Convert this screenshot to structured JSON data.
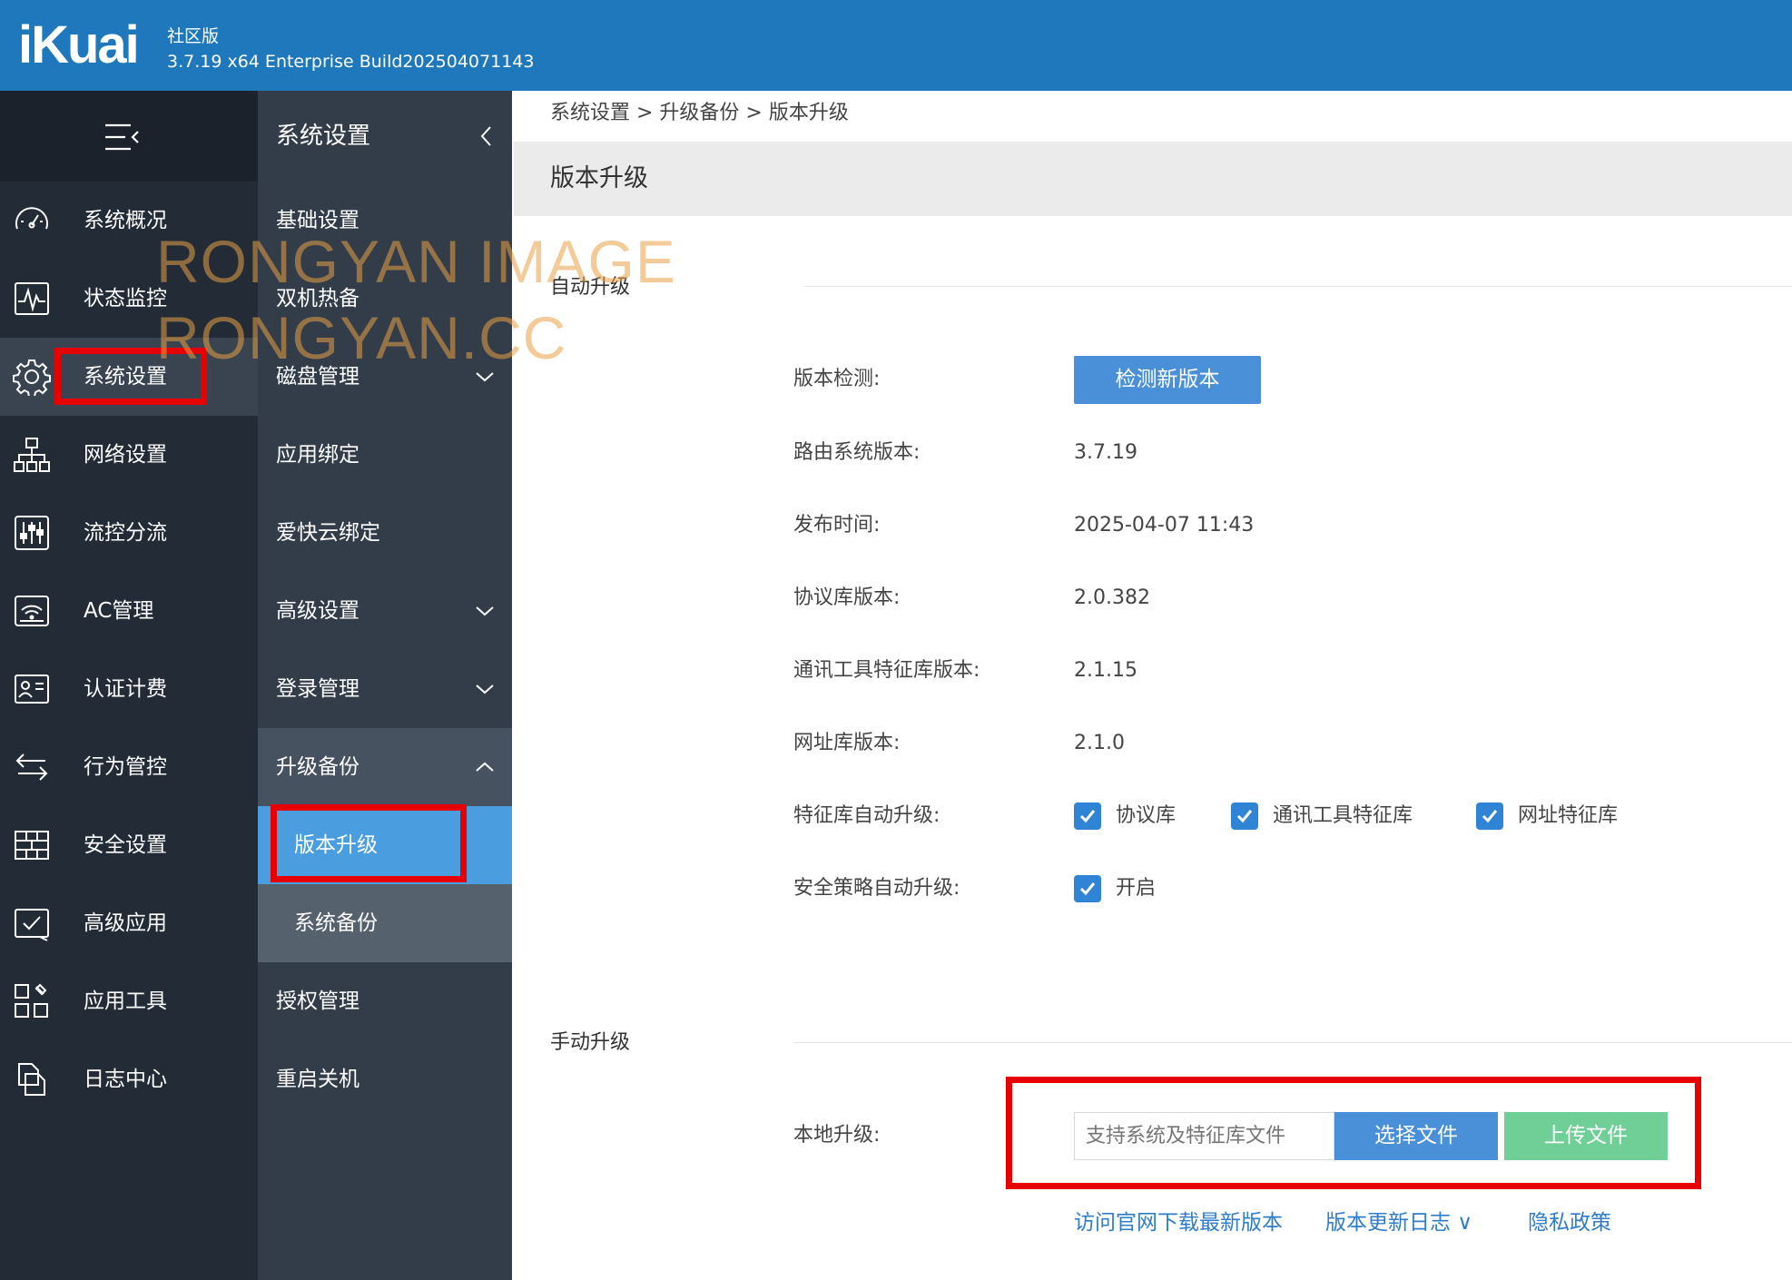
{
  "header": {
    "logo": "iKuai",
    "edition": "社区版",
    "build": "3.7.19 x64 Enterprise Build202504071143"
  },
  "nav1": {
    "items": [
      {
        "label": "系统概况",
        "icon": "dashboard-gauge-icon"
      },
      {
        "label": "状态监控",
        "icon": "monitor-pulse-icon"
      },
      {
        "label": "系统设置",
        "icon": "gear-icon"
      },
      {
        "label": "网络设置",
        "icon": "network-topology-icon"
      },
      {
        "label": "流控分流",
        "icon": "sliders-icon"
      },
      {
        "label": "AC管理",
        "icon": "wifi-router-icon"
      },
      {
        "label": "认证计费",
        "icon": "id-card-icon"
      },
      {
        "label": "行为管控",
        "icon": "swap-arrows-icon"
      },
      {
        "label": "安全设置",
        "icon": "firewall-brick-icon"
      },
      {
        "label": "高级应用",
        "icon": "checklist-icon"
      },
      {
        "label": "应用工具",
        "icon": "app-tools-icon"
      },
      {
        "label": "日志中心",
        "icon": "log-documents-icon"
      }
    ],
    "active": "系统设置"
  },
  "nav2": {
    "title": "系统设置",
    "items": [
      "基础设置",
      "双机热备",
      "磁盘管理",
      "应用绑定",
      "爱快云绑定",
      "高级设置",
      "登录管理",
      "升级备份",
      "版本升级",
      "系统备份",
      "授权管理",
      "重启关机"
    ]
  },
  "breadcrumb": "系统设置 > 升级备份 > 版本升级",
  "page_title": "版本升级",
  "auto_upgrade": {
    "section_title": "自动升级",
    "check_label": "版本检测:",
    "check_button": "检测新版本",
    "rows": [
      {
        "label": "路由系统版本:",
        "value": "3.7.19"
      },
      {
        "label": "发布时间:",
        "value": "2025-04-07 11:43"
      },
      {
        "label": "协议库版本:",
        "value": "2.0.382"
      },
      {
        "label": "通讯工具特征库版本:",
        "value": "2.1.15"
      },
      {
        "label": "网址库版本:",
        "value": "2.1.0"
      }
    ],
    "feature_auto_label": "特征库自动升级:",
    "feature_options": [
      {
        "label": "协议库",
        "checked": true
      },
      {
        "label": "通讯工具特征库",
        "checked": true
      },
      {
        "label": "网址特征库",
        "checked": true
      }
    ],
    "policy_auto_label": "安全策略自动升级:",
    "policy_option": {
      "label": "开启",
      "checked": true
    }
  },
  "manual_upgrade": {
    "section_title": "手动升级",
    "local_label": "本地升级:",
    "file_placeholder": "支持系统及特征库文件",
    "choose_button": "选择文件",
    "upload_button": "上传文件"
  },
  "links": {
    "download": "访问官网下载最新版本",
    "changelog": "版本更新日志 ∨",
    "privacy": "隐私政策"
  },
  "watermark": {
    "line1": "RONGYAN IMAGE",
    "line2": "RONGYAN.CC"
  },
  "colors": {
    "header": "#1f78bb",
    "nav_dark": "#222b36",
    "subnav": "#333d49",
    "primary_button": "#4a90d9",
    "upload_button": "#6fcf97",
    "highlight": "#e60000",
    "link": "#2f7cc9"
  }
}
